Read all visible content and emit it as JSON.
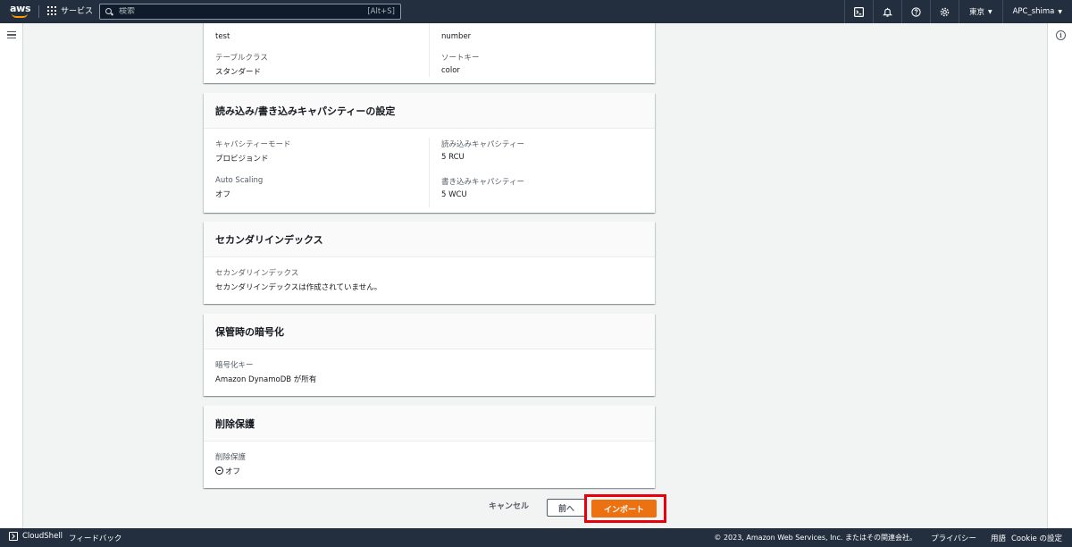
{
  "topnav": {
    "logo": "aws",
    "services": "サービス",
    "search_placeholder": "検索",
    "search_shortcut": "[Alt+S]",
    "region": "東京",
    "user": "APC_shima",
    "icons": [
      "cloudshell-icon",
      "bell-icon",
      "help-icon",
      "gear-icon"
    ]
  },
  "table_card": {
    "row1": {
      "left_value": "test",
      "right_value": "number"
    },
    "row2": {
      "left_label": "テーブルクラス",
      "left_value": "スタンダード",
      "right_label": "ソートキー",
      "right_value": "color"
    }
  },
  "capacity_card": {
    "title": "読み込み/書き込みキャパシティーの設定",
    "capacity_mode_label": "キャパシティーモード",
    "capacity_mode_value": "プロビジョンド",
    "read_capacity_label": "読み込みキャパシティー",
    "read_capacity_value": "5 RCU",
    "auto_scaling_label": "Auto Scaling",
    "auto_scaling_value": "オフ",
    "write_capacity_label": "書き込みキャパシティー",
    "write_capacity_value": "5 WCU"
  },
  "secondary_index_card": {
    "title": "セカンダリインデックス",
    "label": "セカンダリインデックス",
    "value": "セカンダリインデックスは作成されていません。"
  },
  "encryption_card": {
    "title": "保管時の暗号化",
    "label": "暗号化キー",
    "value": "Amazon DynamoDB が所有"
  },
  "deletion_card": {
    "title": "削除保護",
    "label": "削除保護",
    "value": "オフ"
  },
  "actions": {
    "cancel": "キャンセル",
    "previous": "前へ",
    "import": "インポート"
  },
  "bottombar": {
    "cloudshell": "CloudShell",
    "feedback": "フィードバック",
    "copyright": "© 2023, Amazon Web Services, Inc. またはその関連会社。",
    "privacy": "プライバシー",
    "terms": "用語",
    "cookie": "Cookie の設定"
  },
  "colors": {
    "nav_bg": "#232f3e",
    "primary_button": "#ec7211",
    "highlight_border": "#e8000b"
  }
}
